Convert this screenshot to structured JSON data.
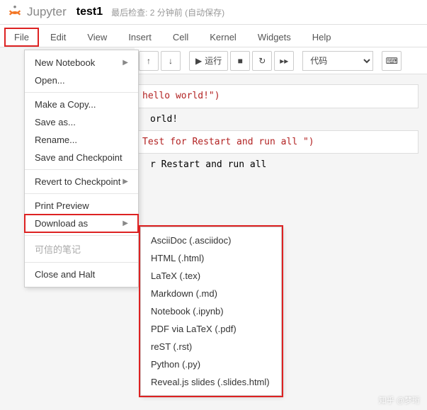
{
  "header": {
    "brand": "Jupyter",
    "title": "test1",
    "checkpoint": "最后检查: 2 分钟前  (自动保存)"
  },
  "menubar": {
    "items": [
      "File",
      "Edit",
      "View",
      "Insert",
      "Cell",
      "Kernel",
      "Widgets",
      "Help"
    ],
    "active_index": 0
  },
  "toolbar": {
    "run_label": "运行",
    "celltype": "代码"
  },
  "file_menu": {
    "new_notebook": "New Notebook",
    "open": "Open...",
    "make_copy": "Make a Copy...",
    "save_as": "Save as...",
    "rename": "Rename...",
    "save_checkpoint": "Save and Checkpoint",
    "revert": "Revert to Checkpoint",
    "print_preview": "Print Preview",
    "download_as": "Download as",
    "trusted": "可信的笔记",
    "close_halt": "Close and Halt"
  },
  "download_submenu": [
    "AsciiDoc (.asciidoc)",
    "HTML (.html)",
    "LaTeX (.tex)",
    "Markdown (.md)",
    "Notebook (.ipynb)",
    "PDF via LaTeX (.pdf)",
    "reST (.rst)",
    "Python (.py)",
    "Reveal.js slides (.slides.html)"
  ],
  "cells": {
    "c1_code": "hello world!\")",
    "c1_out": "orld!",
    "c2_code": "Test for Restart and run all \")",
    "c2_out": "r Restart and run all"
  },
  "watermark": "知乎 @梦珩"
}
